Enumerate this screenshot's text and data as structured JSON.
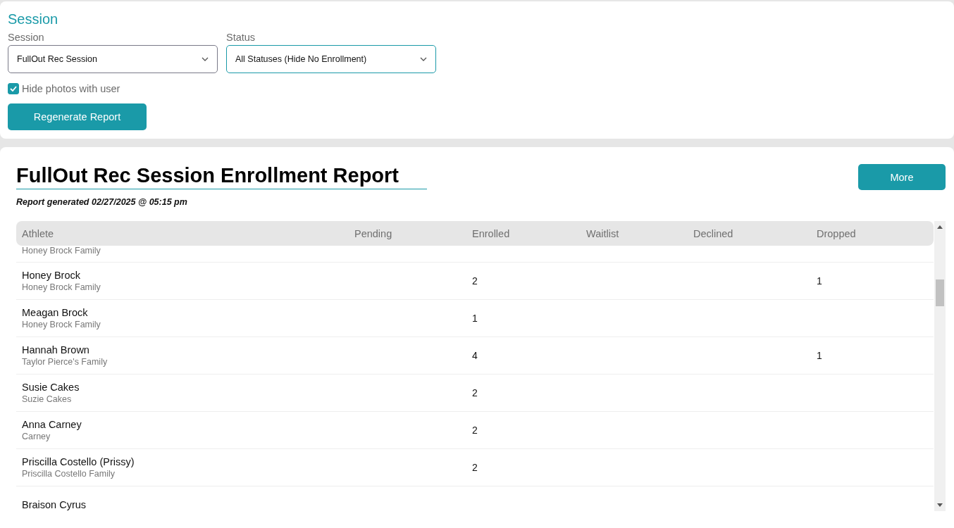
{
  "filters": {
    "heading": "Session",
    "session": {
      "label": "Session",
      "value": "FullOut Rec Session"
    },
    "status": {
      "label": "Status",
      "value": "All Statuses (Hide No Enrollment)"
    },
    "hide_photos": {
      "label": "Hide photos with user",
      "checked": true
    },
    "regenerate_button": "Regenerate Report"
  },
  "report": {
    "title": "FullOut Rec Session Enrollment Report",
    "generated": "Report generated 02/27/2025 @ 05:15 pm",
    "more_button": "More",
    "table": {
      "columns": [
        "Athlete",
        "Pending",
        "Enrolled",
        "Waitlist",
        "Declined",
        "Dropped"
      ],
      "rows": [
        {
          "family": "Honey Brock Family"
        },
        {
          "name": "Honey Brock",
          "family": "Honey Brock Family",
          "enrolled": "2",
          "dropped": "1"
        },
        {
          "name": "Meagan Brock",
          "family": "Honey Brock Family",
          "enrolled": "1"
        },
        {
          "name": "Hannah Brown",
          "family": "Taylor Pierce's Family",
          "enrolled": "4",
          "dropped": "1"
        },
        {
          "name": "Susie Cakes",
          "family": "Suzie Cakes",
          "enrolled": "2"
        },
        {
          "name": "Anna Carney",
          "family": "Carney",
          "enrolled": "2"
        },
        {
          "name": "Priscilla Costello (Prissy)",
          "family": "Priscilla Costello Family",
          "enrolled": "2"
        },
        {
          "name": "Braison Cyrus"
        }
      ]
    }
  }
}
